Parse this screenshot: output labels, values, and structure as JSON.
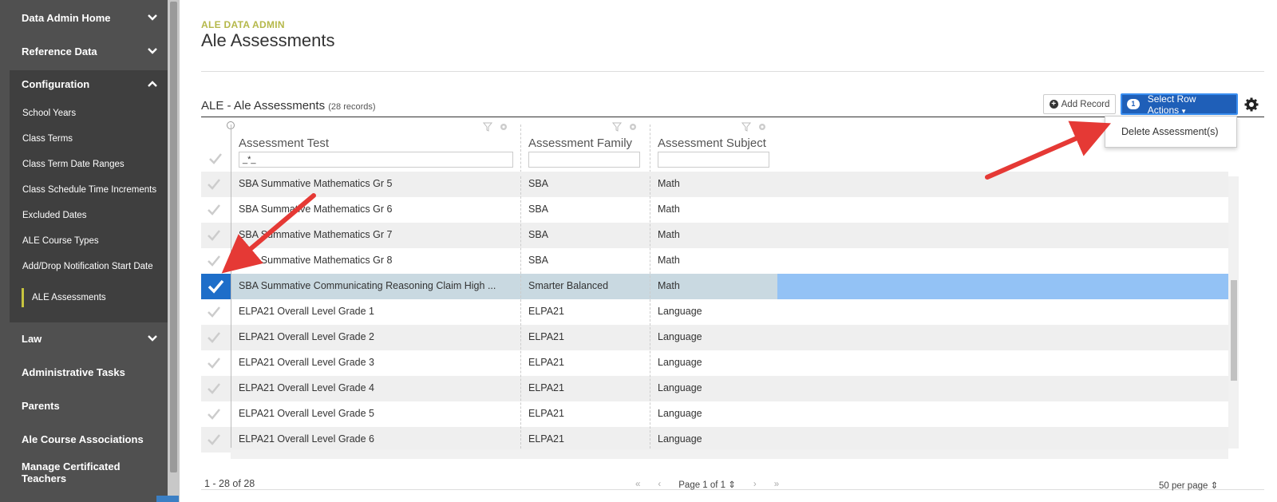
{
  "sidebar": {
    "top_items": [
      {
        "label": "Data Admin Home"
      },
      {
        "label": "Reference Data"
      }
    ],
    "config": {
      "label": "Configuration",
      "items": [
        {
          "label": "School Years"
        },
        {
          "label": "Class Terms"
        },
        {
          "label": "Class Term Date Ranges"
        },
        {
          "label": "Class Schedule Time Increments"
        },
        {
          "label": "Excluded Dates"
        },
        {
          "label": "ALE Course Types"
        },
        {
          "label": "Add/Drop Notification Start Date"
        },
        {
          "label": "ALE Assessments"
        }
      ]
    },
    "bottom_items": [
      {
        "label": "Law"
      },
      {
        "label": "Administrative Tasks"
      },
      {
        "label": "Parents"
      },
      {
        "label": "Ale Course Associations"
      },
      {
        "label": "Manage Certificated Teachers"
      }
    ]
  },
  "header": {
    "overline": "ALE DATA ADMIN",
    "title": "Ale Assessments"
  },
  "grid": {
    "title": "ALE - Ale Assessments",
    "record_count": "(28 records)",
    "add_record_label": "Add Record",
    "row_actions_label": "Select Row Actions",
    "selected_count": "1",
    "dropdown_item": "Delete Assessment(s)",
    "columns": [
      {
        "label": "Assessment Test",
        "filter": "_*_"
      },
      {
        "label": "Assessment Family",
        "filter": ""
      },
      {
        "label": "Assessment Subject",
        "filter": ""
      }
    ],
    "rows": [
      {
        "test": "SBA Summative Mathematics Gr 5",
        "family": "SBA",
        "subject": "Math",
        "selected": false
      },
      {
        "test": "SBA Summative Mathematics Gr 6",
        "family": "SBA",
        "subject": "Math",
        "selected": false
      },
      {
        "test": "SBA Summative Mathematics Gr 7",
        "family": "SBA",
        "subject": "Math",
        "selected": false
      },
      {
        "test": "SBA Summative Mathematics Gr 8",
        "family": "SBA",
        "subject": "Math",
        "selected": false
      },
      {
        "test": "SBA Summative Communicating Reasoning Claim High ...",
        "family": "Smarter Balanced",
        "subject": "Math",
        "selected": true
      },
      {
        "test": "ELPA21 Overall Level Grade 1",
        "family": "ELPA21",
        "subject": "Language",
        "selected": false
      },
      {
        "test": "ELPA21 Overall Level Grade 2",
        "family": "ELPA21",
        "subject": "Language",
        "selected": false
      },
      {
        "test": "ELPA21 Overall Level Grade 3",
        "family": "ELPA21",
        "subject": "Language",
        "selected": false
      },
      {
        "test": "ELPA21 Overall Level Grade 4",
        "family": "ELPA21",
        "subject": "Language",
        "selected": false
      },
      {
        "test": "ELPA21 Overall Level Grade 5",
        "family": "ELPA21",
        "subject": "Language",
        "selected": false
      },
      {
        "test": "ELPA21 Overall Level Grade 6",
        "family": "ELPA21",
        "subject": "Language",
        "selected": false
      }
    ]
  },
  "pager": {
    "range": "1 - 28 of 28",
    "page": "Page 1 of 1",
    "per_page": "50 per page"
  },
  "colors": {
    "sidebar_bg": "#505050",
    "accent_olive": "#b5b84a",
    "primary_blue": "#1f5fb8",
    "selected_row": "#c9d9e1",
    "annotation_arrow": "#e53935"
  }
}
